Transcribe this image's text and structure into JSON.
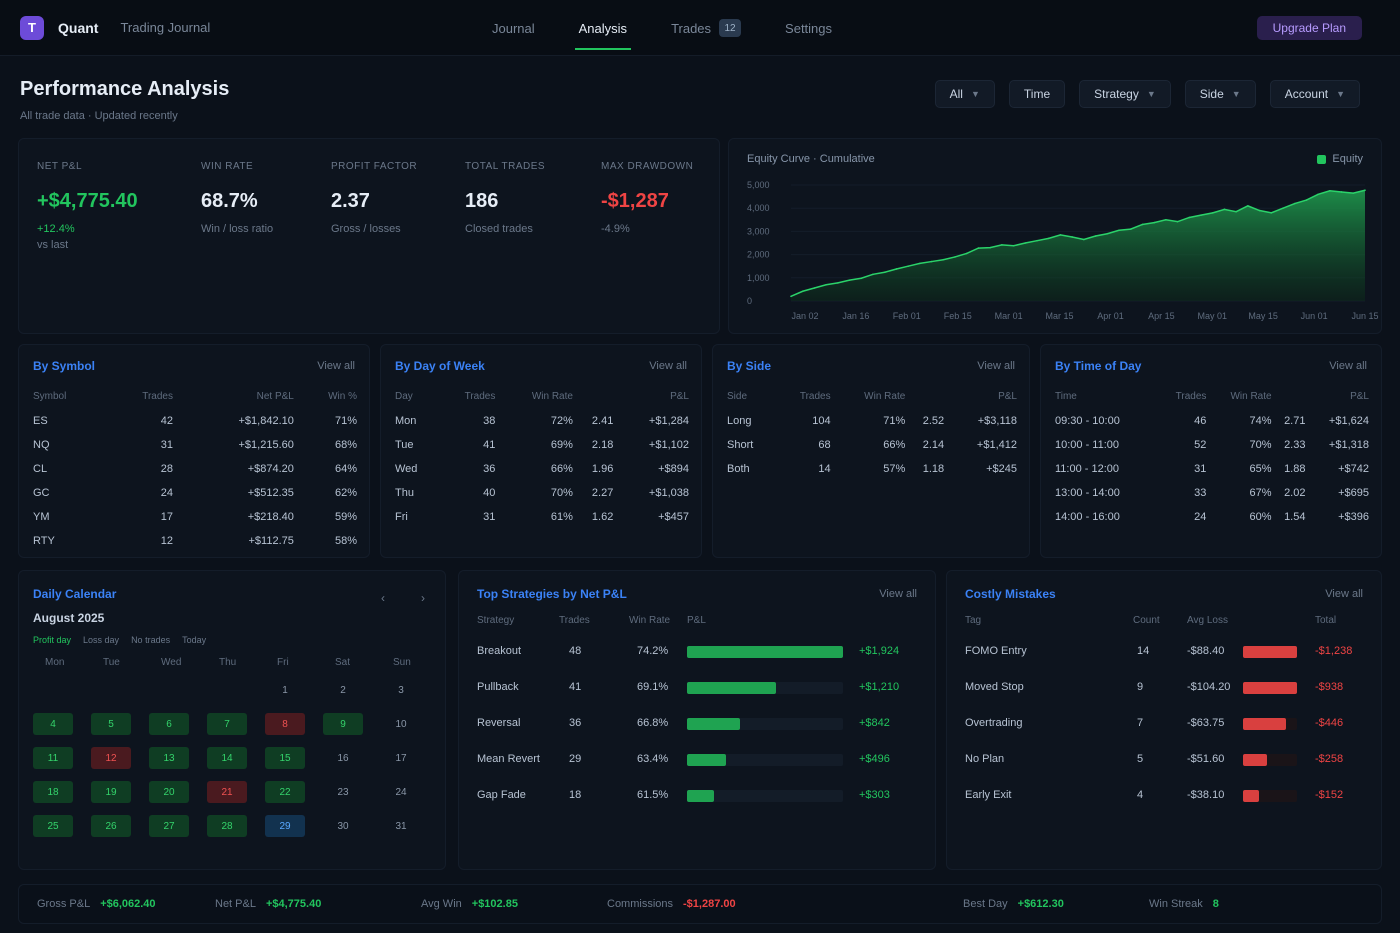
{
  "header": {
    "logo_letter": "T",
    "brand": "Quant",
    "brand_sub": "Trading Journal",
    "nav": [
      {
        "label": "Journal",
        "active": false
      },
      {
        "label": "Analysis",
        "active": true
      },
      {
        "label": "Trades",
        "active": false,
        "badge": "12"
      },
      {
        "label": "Settings",
        "active": false
      }
    ],
    "upgrade_label": "Upgrade Plan"
  },
  "page": {
    "title": "Performance Analysis",
    "subtitle": "All trade data · Updated recently",
    "filters": [
      "All",
      "Time",
      "Strategy",
      "Side",
      "Account"
    ]
  },
  "stats": [
    {
      "label": "Net P&L",
      "value": "+$4,775.40",
      "sub": "+12.4%",
      "sub2": "vs last",
      "tone": "green"
    },
    {
      "label": "Win Rate",
      "value": "68.7%",
      "sub": "Win / loss ratio",
      "tone": "neutral"
    },
    {
      "label": "Profit Factor",
      "value": "2.37",
      "sub": "Gross / losses",
      "tone": "neutral"
    },
    {
      "label": "Total Trades",
      "value": "186",
      "sub": "Closed trades",
      "tone": "neutral"
    },
    {
      "label": "Max Drawdown",
      "value": "-$1,287",
      "sub": "-4.9%",
      "tone": "red"
    }
  ],
  "equity": {
    "title": "Equity Curve · Cumulative",
    "legend": "Equity",
    "y_ticks": [
      "5,000",
      "4,000",
      "3,000",
      "2,000",
      "1,000",
      "0"
    ],
    "x_ticks": [
      "Jan 02",
      "Jan 16",
      "Feb 01",
      "Feb 15",
      "Mar 01",
      "Mar 15",
      "Apr 01",
      "Apr 15",
      "May 01",
      "May 15",
      "Jun 01",
      "Jun 15"
    ]
  },
  "chart_data": {
    "type": "area",
    "series": [
      {
        "name": "Equity",
        "values": [
          200,
          420,
          560,
          700,
          780,
          900,
          980,
          1150,
          1240,
          1380,
          1500,
          1620,
          1700,
          1780,
          1900,
          2050,
          2280,
          2300,
          2420,
          2380,
          2500,
          2600,
          2700,
          2850,
          2760,
          2650,
          2800,
          2900,
          3050,
          3100,
          3300,
          3380,
          3500,
          3420,
          3600,
          3700,
          3800,
          3950,
          3850,
          4100,
          3900,
          3800,
          4000,
          4200,
          4350,
          4600,
          4750,
          4700,
          4650,
          4775
        ]
      }
    ],
    "ylim": [
      0,
      5000
    ]
  },
  "tables": {
    "by_symbol": {
      "title": "By Symbol",
      "link": "View all",
      "headers": [
        "Symbol",
        "Trades",
        "Net P&L",
        "",
        "Win %"
      ],
      "rows": [
        [
          "ES",
          "42",
          "+$1,842.10",
          "",
          "71%"
        ],
        [
          "NQ",
          "31",
          "+$1,215.60",
          "",
          "68%"
        ],
        [
          "CL",
          "28",
          "+$874.20",
          "",
          "64%"
        ],
        [
          "GC",
          "24",
          "+$512.35",
          "",
          "62%"
        ],
        [
          "YM",
          "17",
          "+$218.40",
          "",
          "59%"
        ],
        [
          "RTY",
          "12",
          "+$112.75",
          "",
          "58%"
        ]
      ]
    },
    "by_day": {
      "title": "By Day of Week",
      "link": "View all",
      "headers": [
        "Day",
        "Trades",
        "Win Rate",
        "",
        "P&L"
      ],
      "rows": [
        [
          "Mon",
          "38",
          "72%",
          "2.41",
          "+$1,284"
        ],
        [
          "Tue",
          "41",
          "69%",
          "2.18",
          "+$1,102"
        ],
        [
          "Wed",
          "36",
          "66%",
          "1.96",
          "+$894"
        ],
        [
          "Thu",
          "40",
          "70%",
          "2.27",
          "+$1,038"
        ],
        [
          "Fri",
          "31",
          "61%",
          "1.62",
          "+$457"
        ]
      ]
    },
    "by_side": {
      "title": "By Side",
      "link": "View all",
      "headers": [
        "Side",
        "Trades",
        "Win Rate",
        "",
        "P&L"
      ],
      "rows": [
        [
          "Long",
          "104",
          "71%",
          "2.52",
          "+$3,118"
        ],
        [
          "Short",
          "68",
          "66%",
          "2.14",
          "+$1,412"
        ],
        [
          "Both",
          "14",
          "57%",
          "1.18",
          "+$245"
        ]
      ]
    },
    "by_hour": {
      "title": "By Time of Day",
      "link": "View all",
      "headers": [
        "Time",
        "Trades",
        "Win Rate",
        "",
        "P&L"
      ],
      "rows": [
        [
          "09:30 - 10:00",
          "46",
          "74%",
          "2.71",
          "+$1,624"
        ],
        [
          "10:00 - 11:00",
          "52",
          "70%",
          "2.33",
          "+$1,318"
        ],
        [
          "11:00 - 12:00",
          "31",
          "65%",
          "1.88",
          "+$742"
        ],
        [
          "13:00 - 14:00",
          "33",
          "67%",
          "2.02",
          "+$695"
        ],
        [
          "14:00 - 16:00",
          "24",
          "60%",
          "1.54",
          "+$396"
        ]
      ]
    }
  },
  "calendar": {
    "title": "Daily Calendar",
    "month": "August 2025",
    "legend": [
      "Profit day",
      "Loss day",
      "No trades",
      "Today"
    ],
    "weekdays": [
      "Mon",
      "Tue",
      "Wed",
      "Thu",
      "Fri",
      "Sat",
      "Sun"
    ],
    "cells": [
      {
        "d": "",
        "s": "none"
      },
      {
        "d": "",
        "s": "none"
      },
      {
        "d": "",
        "s": "none"
      },
      {
        "d": "",
        "s": "none"
      },
      {
        "d": "1",
        "s": "none"
      },
      {
        "d": "2",
        "s": "none"
      },
      {
        "d": "3",
        "s": "none"
      },
      {
        "d": "4",
        "s": "win"
      },
      {
        "d": "5",
        "s": "win"
      },
      {
        "d": "6",
        "s": "win"
      },
      {
        "d": "7",
        "s": "win"
      },
      {
        "d": "8",
        "s": "loss"
      },
      {
        "d": "9",
        "s": "win"
      },
      {
        "d": "10",
        "s": "none"
      },
      {
        "d": "11",
        "s": "win"
      },
      {
        "d": "12",
        "s": "loss"
      },
      {
        "d": "13",
        "s": "win"
      },
      {
        "d": "14",
        "s": "win"
      },
      {
        "d": "15",
        "s": "win"
      },
      {
        "d": "16",
        "s": "none"
      },
      {
        "d": "17",
        "s": "none"
      },
      {
        "d": "18",
        "s": "win"
      },
      {
        "d": "19",
        "s": "win"
      },
      {
        "d": "20",
        "s": "win"
      },
      {
        "d": "21",
        "s": "loss"
      },
      {
        "d": "22",
        "s": "win"
      },
      {
        "d": "23",
        "s": "none"
      },
      {
        "d": "24",
        "s": "none"
      },
      {
        "d": "25",
        "s": "win"
      },
      {
        "d": "26",
        "s": "win"
      },
      {
        "d": "27",
        "s": "win"
      },
      {
        "d": "28",
        "s": "win"
      },
      {
        "d": "29",
        "s": "today"
      },
      {
        "d": "30",
        "s": "none"
      },
      {
        "d": "31",
        "s": "none"
      }
    ]
  },
  "strategies": {
    "title": "Top Strategies by Net P&L",
    "link": "View all",
    "headers": [
      "Strategy",
      "Trades",
      "Win Rate",
      "P&L",
      ""
    ],
    "rows": [
      {
        "name": "Breakout",
        "trades": "48",
        "win": "74.2%",
        "pnl": "+$1,924",
        "pct": 100
      },
      {
        "name": "Pullback",
        "trades": "41",
        "win": "69.1%",
        "pnl": "+$1,210",
        "pct": 57
      },
      {
        "name": "Reversal",
        "trades": "36",
        "win": "66.8%",
        "pnl": "+$842",
        "pct": 34
      },
      {
        "name": "Mean Revert",
        "trades": "29",
        "win": "63.4%",
        "pnl": "+$496",
        "pct": 25
      },
      {
        "name": "Gap Fade",
        "trades": "18",
        "win": "61.5%",
        "pnl": "+$303",
        "pct": 17
      }
    ]
  },
  "mistakes": {
    "title": "Costly Mistakes",
    "link": "View all",
    "headers": [
      "Tag",
      "Count",
      "Avg Loss",
      "",
      "Total"
    ],
    "rows": [
      {
        "name": "FOMO Entry",
        "count": "14",
        "avg": "-$88.40",
        "total": "-$1,238",
        "pct": 100
      },
      {
        "name": "Moved Stop",
        "count": "9",
        "avg": "-$104.20",
        "total": "-$938",
        "pct": 100
      },
      {
        "name": "Overtrading",
        "count": "7",
        "avg": "-$63.75",
        "total": "-$446",
        "pct": 80
      },
      {
        "name": "No Plan",
        "count": "5",
        "avg": "-$51.60",
        "total": "-$258",
        "pct": 45
      },
      {
        "name": "Early Exit",
        "count": "4",
        "avg": "-$38.10",
        "total": "-$152",
        "pct": 30
      }
    ]
  },
  "footer": [
    {
      "label": "Gross P&L",
      "value": "+$6,062.40",
      "tone": "g"
    },
    {
      "label": "Net P&L",
      "value": "+$4,775.40",
      "tone": "g"
    },
    {
      "label": "Avg Win",
      "value": "+$102.85",
      "tone": "g"
    },
    {
      "label": "Commissions",
      "value": "-$1,287.00",
      "tone": "r"
    },
    {
      "label": "Best Day",
      "value": "+$612.30",
      "tone": "g"
    },
    {
      "label": "Win Streak",
      "value": "8",
      "tone": "g"
    }
  ]
}
